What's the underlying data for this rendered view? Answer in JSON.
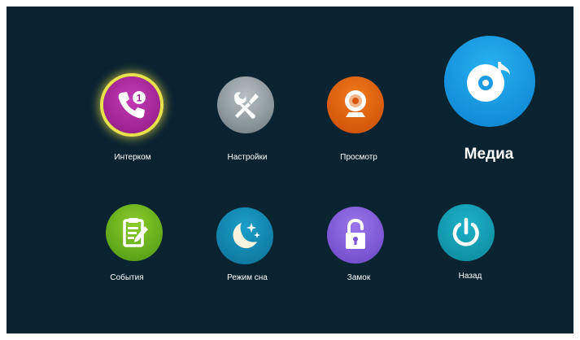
{
  "menu": {
    "items": [
      {
        "id": "intercom",
        "label": "Интерком",
        "icon": "phone-icon",
        "badge": "1",
        "selected": true
      },
      {
        "id": "settings",
        "label": "Настройки",
        "icon": "tools-icon"
      },
      {
        "id": "view",
        "label": "Просмотр",
        "icon": "webcam-icon"
      },
      {
        "id": "media",
        "label": "Медиа",
        "icon": "music-disc-icon",
        "highlighted": true
      },
      {
        "id": "events",
        "label": "События",
        "icon": "clipboard-icon"
      },
      {
        "id": "sleep",
        "label": "Режим сна",
        "icon": "moon-stars-icon"
      },
      {
        "id": "lock",
        "label": "Замок",
        "icon": "unlock-icon"
      },
      {
        "id": "back",
        "label": "Назад",
        "icon": "power-icon"
      }
    ]
  },
  "colors": {
    "background": "#0a2331",
    "selection_ring": "#e9e14c",
    "intercom": "#a92a9e",
    "settings": "#8e989d",
    "view": "#e0610e",
    "media": "#1a9be4",
    "events": "#6cb21e",
    "sleep": "#1487b2",
    "lock": "#8460dc",
    "back": "#15a0b5"
  }
}
